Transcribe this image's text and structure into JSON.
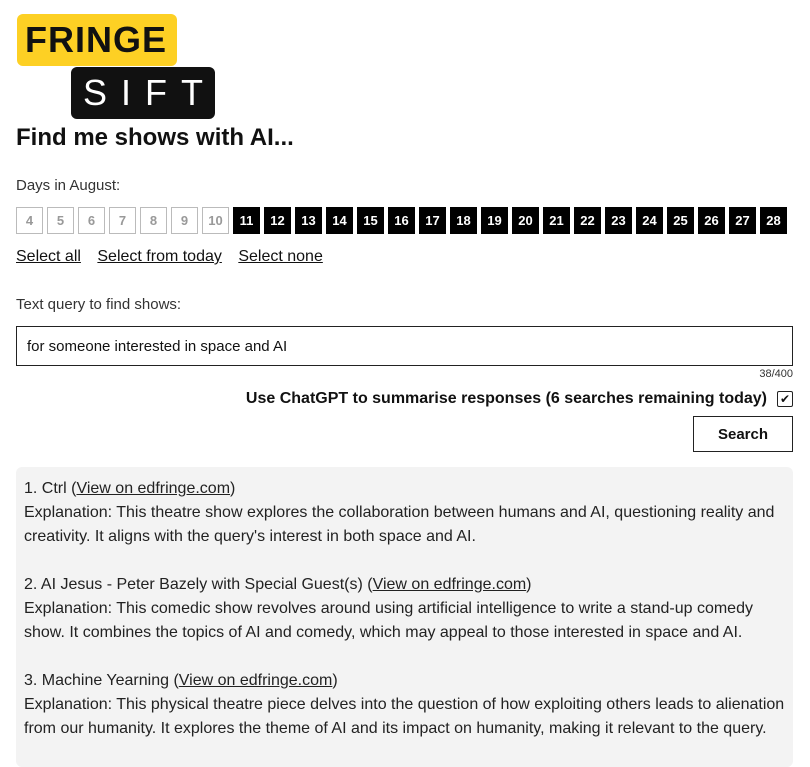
{
  "logo": {
    "top": "FRINGE",
    "bottom": "SIFT"
  },
  "title": "Find me shows with AI...",
  "days_label": "Days in August:",
  "days": [
    {
      "n": "4",
      "on": false
    },
    {
      "n": "5",
      "on": false
    },
    {
      "n": "6",
      "on": false
    },
    {
      "n": "7",
      "on": false
    },
    {
      "n": "8",
      "on": false
    },
    {
      "n": "9",
      "on": false
    },
    {
      "n": "10",
      "on": false
    },
    {
      "n": "11",
      "on": true
    },
    {
      "n": "12",
      "on": true
    },
    {
      "n": "13",
      "on": true
    },
    {
      "n": "14",
      "on": true
    },
    {
      "n": "15",
      "on": true
    },
    {
      "n": "16",
      "on": true
    },
    {
      "n": "17",
      "on": true
    },
    {
      "n": "18",
      "on": true
    },
    {
      "n": "19",
      "on": true
    },
    {
      "n": "20",
      "on": true
    },
    {
      "n": "21",
      "on": true
    },
    {
      "n": "22",
      "on": true
    },
    {
      "n": "23",
      "on": true
    },
    {
      "n": "24",
      "on": true
    },
    {
      "n": "25",
      "on": true
    },
    {
      "n": "26",
      "on": true
    },
    {
      "n": "27",
      "on": true
    },
    {
      "n": "28",
      "on": true
    }
  ],
  "links": {
    "select_all": "Select all",
    "select_today": "Select from today",
    "select_none": "Select none"
  },
  "query_label": "Text query to find shows:",
  "query_value": "for someone interested in space and AI",
  "counter": "38/400",
  "gpt_label": "Use ChatGPT to summarise responses (6 searches remaining today)",
  "gpt_checked": true,
  "search_label": "Search",
  "link_text": "View on edfringe.com",
  "results": [
    {
      "title": "1. Ctrl",
      "explanation": "Explanation: This theatre show explores the collaboration between humans and AI, questioning reality and creativity. It aligns with the query's interest in both space and AI."
    },
    {
      "title": "2. AI Jesus - Peter Bazely with Special Guest(s)",
      "explanation": "Explanation: This comedic show revolves around using artificial intelligence to write a stand-up comedy show. It combines the topics of AI and comedy, which may appeal to those interested in space and AI."
    },
    {
      "title": "3. Machine Yearning",
      "explanation": "Explanation: This physical theatre piece delves into the question of how exploiting others leads to alienation from our humanity. It explores the theme of AI and its impact on humanity, making it relevant to the query."
    }
  ]
}
